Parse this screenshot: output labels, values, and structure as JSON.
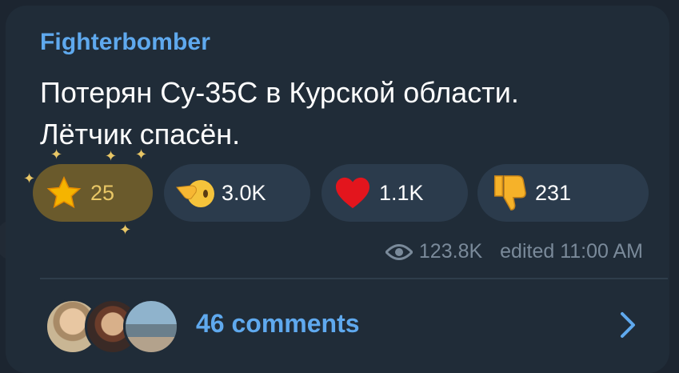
{
  "channel": {
    "name": "Fighterbomber"
  },
  "message": {
    "line1": "Потерян Су-35С в Курской области.",
    "line2": "Лётчик спасён."
  },
  "reactions": [
    {
      "icon": "star-icon",
      "count": "25"
    },
    {
      "icon": "pointing-hand-face-icon",
      "count": "3.0K"
    },
    {
      "icon": "red-heart-icon",
      "count": "1.1K"
    },
    {
      "icon": "thumbs-down-icon",
      "count": "231"
    }
  ],
  "meta": {
    "views": "123.8K",
    "edited": "edited 11:00 AM"
  },
  "comments": {
    "label": "46 comments"
  },
  "colors": {
    "accent": "#5fa9ee",
    "bubble": "#202c38",
    "reaction_bg": "#2b3b4c",
    "star_active": "#6a5a2c"
  }
}
